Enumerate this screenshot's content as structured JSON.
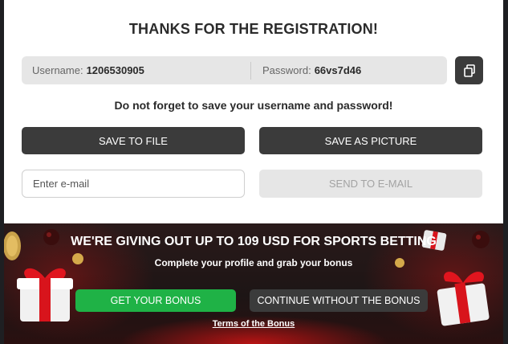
{
  "registration": {
    "title": "THANKS FOR THE REGISTRATION!",
    "username_label": "Username:",
    "username_value": "1206530905",
    "password_label": "Password:",
    "password_value": "66vs7d46",
    "copy_icon": "copy-icon",
    "notice": "Do not forget to save your username and password!",
    "save_to_file": "SAVE TO FILE",
    "save_as_picture": "SAVE AS PICTURE",
    "email_placeholder": "Enter e-mail",
    "send_to_email": "SEND TO E-MAIL"
  },
  "promo": {
    "title": "WE'RE GIVING OUT UP TO 109 USD FOR SPORTS BETTING",
    "subtitle": "Complete your profile and grab your bonus",
    "get_bonus": "GET YOUR BONUS",
    "continue": "CONTINUE WITHOUT THE BONUS",
    "terms": "Terms of the Bonus",
    "accent_green": "#1fb246",
    "accent_red": "#c81414"
  }
}
